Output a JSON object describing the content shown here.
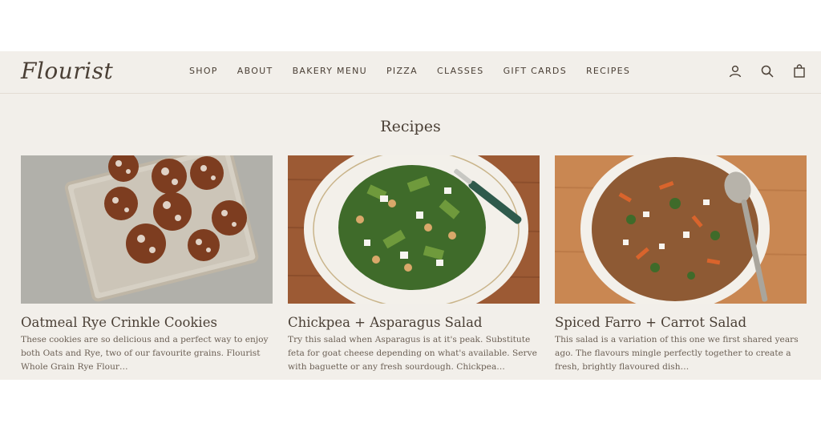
{
  "brand": {
    "logo_text": "Flourist"
  },
  "nav": {
    "items": [
      {
        "label": "SHOP"
      },
      {
        "label": "ABOUT"
      },
      {
        "label": "BAKERY MENU"
      },
      {
        "label": "PIZZA"
      },
      {
        "label": "CLASSES"
      },
      {
        "label": "GIFT CARDS"
      },
      {
        "label": "RECIPES"
      }
    ]
  },
  "header_icons": [
    "account-icon",
    "search-icon",
    "cart-bag-icon"
  ],
  "page": {
    "title": "Recipes"
  },
  "recipes": [
    {
      "title": "Oatmeal Rye Crinkle Cookies",
      "excerpt": "These cookies are so delicious and a perfect way to enjoy both Oats and Rye, two of our favourite grains. Flourist Whole Grain Rye Flour…",
      "image": "cookies-on-baking-tray-image"
    },
    {
      "title": "Chickpea + Asparagus Salad",
      "excerpt": "Try this salad when Asparagus is at it's peak. Substitute feta for goat cheese depending on what's available. Serve with baguette or any fresh sourdough. Chickpea…",
      "image": "chickpea-asparagus-salad-plate-image"
    },
    {
      "title": "Spiced Farro + Carrot Salad",
      "excerpt": "This salad is a variation of this one we first shared years ago. The flavours mingle perfectly together to create a fresh, brightly flavoured dish…",
      "image": "farro-carrot-salad-bowl-image"
    }
  ],
  "colors": {
    "background": "#f2efea",
    "text": "#4a3f35",
    "muted": "#6b5f54"
  }
}
